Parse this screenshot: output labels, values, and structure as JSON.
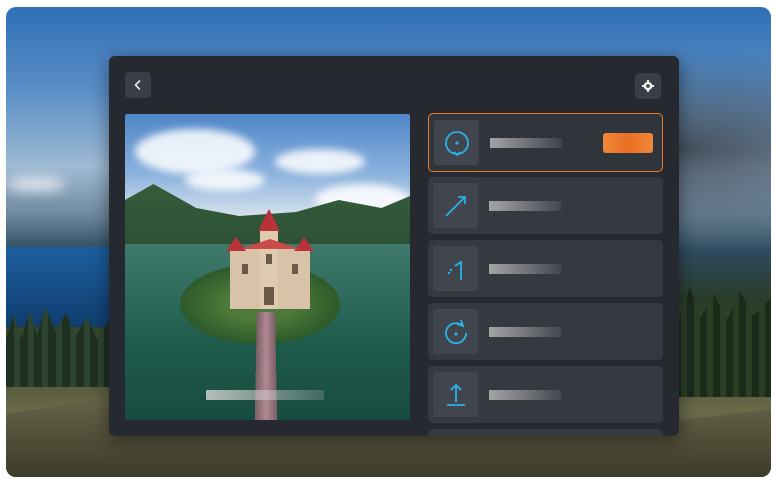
{
  "colors": {
    "accent": "#e96f22",
    "panel": "#262a30",
    "card": "#353a41",
    "icon": "#2ab3e8"
  },
  "header": {
    "back_icon": "chevron-left-icon",
    "settings_icon": "gear-icon"
  },
  "modes": [
    {
      "icon": "point-of-interest-icon",
      "selected": true
    },
    {
      "icon": "straight-path-icon",
      "selected": false
    },
    {
      "icon": "turn-path-icon",
      "selected": false
    },
    {
      "icon": "rotate-icon",
      "selected": false
    },
    {
      "icon": "ascend-icon",
      "selected": false
    }
  ]
}
